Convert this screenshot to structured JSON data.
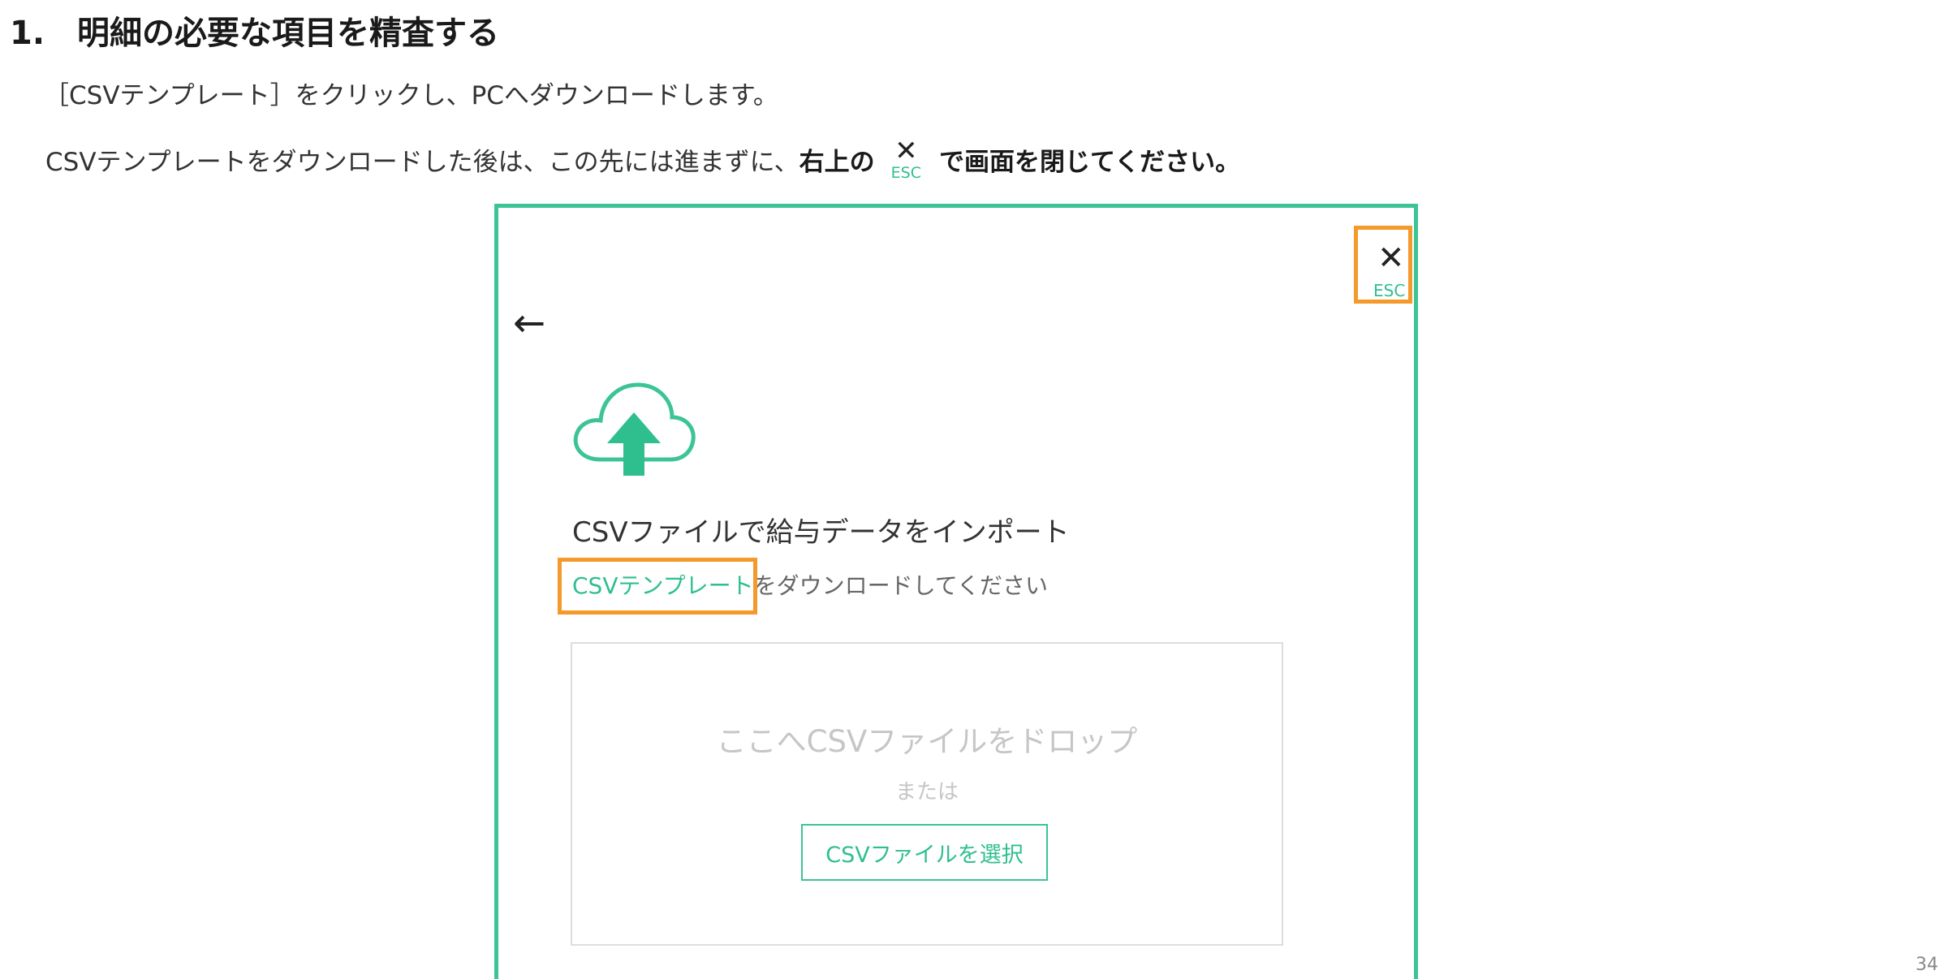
{
  "heading": {
    "number": "1.",
    "title": "明細の必要な項目を精査する"
  },
  "instructions": {
    "line1": "［CSVテンプレート］をクリックし、PCへダウンロードします。",
    "line2_prefix": "CSVテンプレートをダウンロードした後は、この先には進まずに、",
    "line2_bold1": "右上の",
    "line2_bold2": "で画面を閉じてください。",
    "inline_close_symbol": "✕",
    "inline_esc_label": "ESC"
  },
  "screenshot": {
    "close_symbol": "✕",
    "close_esc_label": "ESC",
    "back_arrow": "←",
    "icon": "cloud-upload-icon",
    "import_title": "CSVファイルで給与データをインポート",
    "template_link": "CSVテンプレート",
    "template_suffix": "をダウンロードしてください",
    "dropzone": {
      "drop_text": "ここへCSVファイルをドロップ",
      "or_text": "または",
      "select_button": "CSVファイルを選択"
    }
  },
  "colors": {
    "accent_green": "#3cc497",
    "highlight_orange": "#f39a2b"
  },
  "page_number": "34"
}
